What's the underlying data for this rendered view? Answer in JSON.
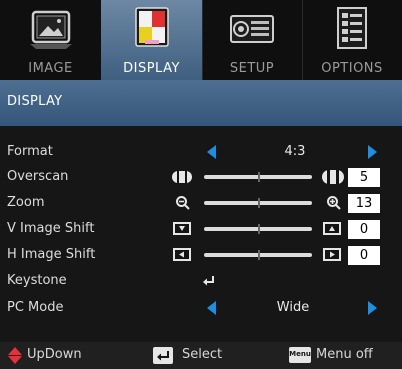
{
  "tabs": [
    {
      "label": "IMAGE",
      "icon": "image-icon"
    },
    {
      "label": "DISPLAY",
      "icon": "display-icon"
    },
    {
      "label": "SETUP",
      "icon": "projector-icon"
    },
    {
      "label": "OPTIONS",
      "icon": "options-icon"
    }
  ],
  "header": {
    "title": "DISPLAY"
  },
  "rows": [
    {
      "label": "Format",
      "value": "4:3"
    },
    {
      "label": "Overscan",
      "value": "5",
      "level": 0.5
    },
    {
      "label": "Zoom",
      "value": "13",
      "level": 0.5
    },
    {
      "label": "V Image Shift",
      "value": "0",
      "level": 0.5
    },
    {
      "label": "H Image Shift",
      "value": "0",
      "level": 0.5
    },
    {
      "label": "Keystone"
    },
    {
      "label": "PC Mode",
      "value": "Wide"
    }
  ],
  "footer": {
    "updown": "UpDown",
    "select": "Select",
    "menu_key": "Menu",
    "menu_off": "Menu off"
  },
  "colors": {
    "accent": "#1e8ee0",
    "header": "#3d5f83",
    "active_tab": "#5a7898",
    "footer_arrow": "#e8303a"
  }
}
